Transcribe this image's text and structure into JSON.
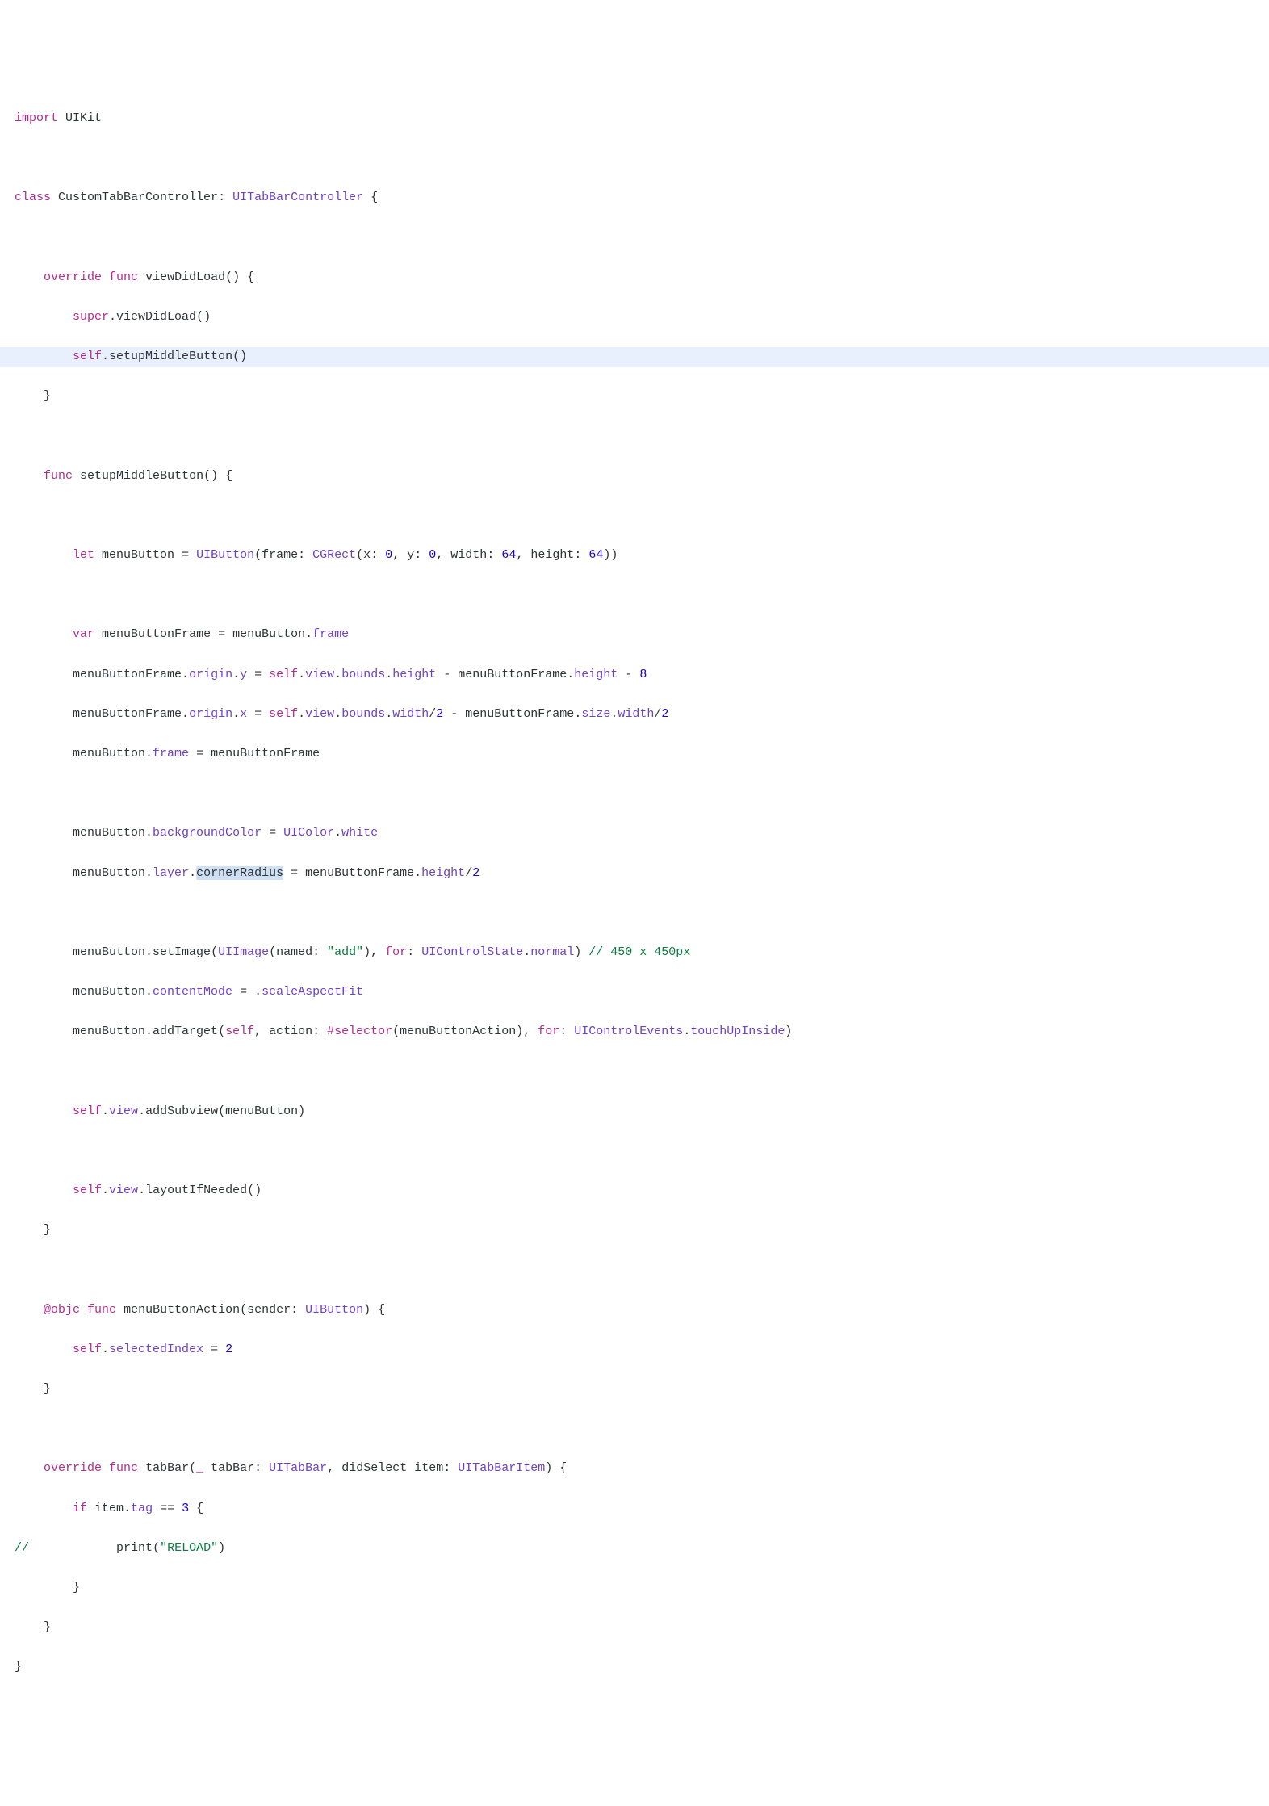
{
  "code": {
    "l1_import": "import",
    "l1_uikit": "UIKit",
    "l3_class": "class",
    "l3_name": "CustomTabBarController",
    "l3_type": "UITabBarController",
    "l5_override": "override",
    "l5_func": "func",
    "l5_name": "viewDidLoad",
    "l6_super": "super",
    "l6_call": "viewDidLoad",
    "l7_self": "self",
    "l7_call": "setupMiddleButton",
    "l10_func": "func",
    "l10_name": "setupMiddleButton",
    "l12_let": "let",
    "l12_var": "menuButton",
    "l12_type": "UIButton",
    "l12_frame": "frame",
    "l12_cgrect": "CGRect",
    "l12_x": "x",
    "l12_xn": "0",
    "l12_y": "y",
    "l12_yn": "0",
    "l12_w": "width",
    "l12_wn": "64",
    "l12_h": "height",
    "l12_hn": "64",
    "l14_var": "var",
    "l14_name": "menuButtonFrame",
    "l14_expr_l": "menuButton",
    "l14_expr_r": "frame",
    "l15_l": "menuButtonFrame",
    "l15_origin": "origin",
    "l15_y": "y",
    "l15_self": "self",
    "l15_view": "view",
    "l15_bounds": "bounds",
    "l15_height": "height",
    "l15_mbf": "menuButtonFrame",
    "l15_h2": "height",
    "l15_n": "8",
    "l16_l": "menuButtonFrame",
    "l16_origin": "origin",
    "l16_x": "x",
    "l16_self": "self",
    "l16_view": "view",
    "l16_bounds": "bounds",
    "l16_width": "width",
    "l16_d1": "2",
    "l16_mbf": "menuButtonFrame",
    "l16_size": "size",
    "l16_w2": "width",
    "l16_d2": "2",
    "l17_l": "menuButton",
    "l17_frame": "frame",
    "l17_r": "menuButtonFrame",
    "l19_l": "menuButton",
    "l19_bg": "backgroundColor",
    "l19_uic": "UIColor",
    "l19_white": "white",
    "l20_l": "menuButton",
    "l20_layer": "layer",
    "l20_cr": "cornerRadius",
    "l20_mbf": "menuButtonFrame",
    "l20_h": "height",
    "l20_d": "2",
    "l22_l": "menuButton",
    "l22_setimg": "setImage",
    "l22_uiimg": "UIImage",
    "l22_named": "named",
    "l22_str": "\"add\"",
    "l22_for": "for",
    "l22_uics": "UIControlState",
    "l22_normal": "normal",
    "l22_comment": "// 450 x 450px",
    "l23_l": "menuButton",
    "l23_cm": "contentMode",
    "l23_saf": "scaleAspectFit",
    "l24_l": "menuButton",
    "l24_at": "addTarget",
    "l24_self": "self",
    "l24_action": "action",
    "l24_sel": "#selector",
    "l24_mba": "menuButtonAction",
    "l24_for": "for",
    "l24_uice": "UIControlEvents",
    "l24_tui": "touchUpInside",
    "l26_self": "self",
    "l26_view": "view",
    "l26_add": "addSubview",
    "l26_arg": "menuButton",
    "l28_self": "self",
    "l28_view": "view",
    "l28_lin": "layoutIfNeeded",
    "l31_objc": "@objc",
    "l31_func": "func",
    "l31_name": "menuButtonAction",
    "l31_sender": "sender",
    "l31_type": "UIButton",
    "l32_self": "self",
    "l32_si": "selectedIndex",
    "l32_n": "2",
    "l35_override": "override",
    "l35_func": "func",
    "l35_name": "tabBar",
    "l35_u": "_",
    "l35_p1": "tabBar",
    "l35_t1": "UITabBar",
    "l35_p2": "didSelect",
    "l35_p2n": "item",
    "l35_t2": "UITabBarItem",
    "l36_if": "if",
    "l36_item": "item",
    "l36_tag": "tag",
    "l36_n": "3",
    "l37_comment": "//",
    "l37_print": "print",
    "l37_str": "\"RELOAD\""
  }
}
